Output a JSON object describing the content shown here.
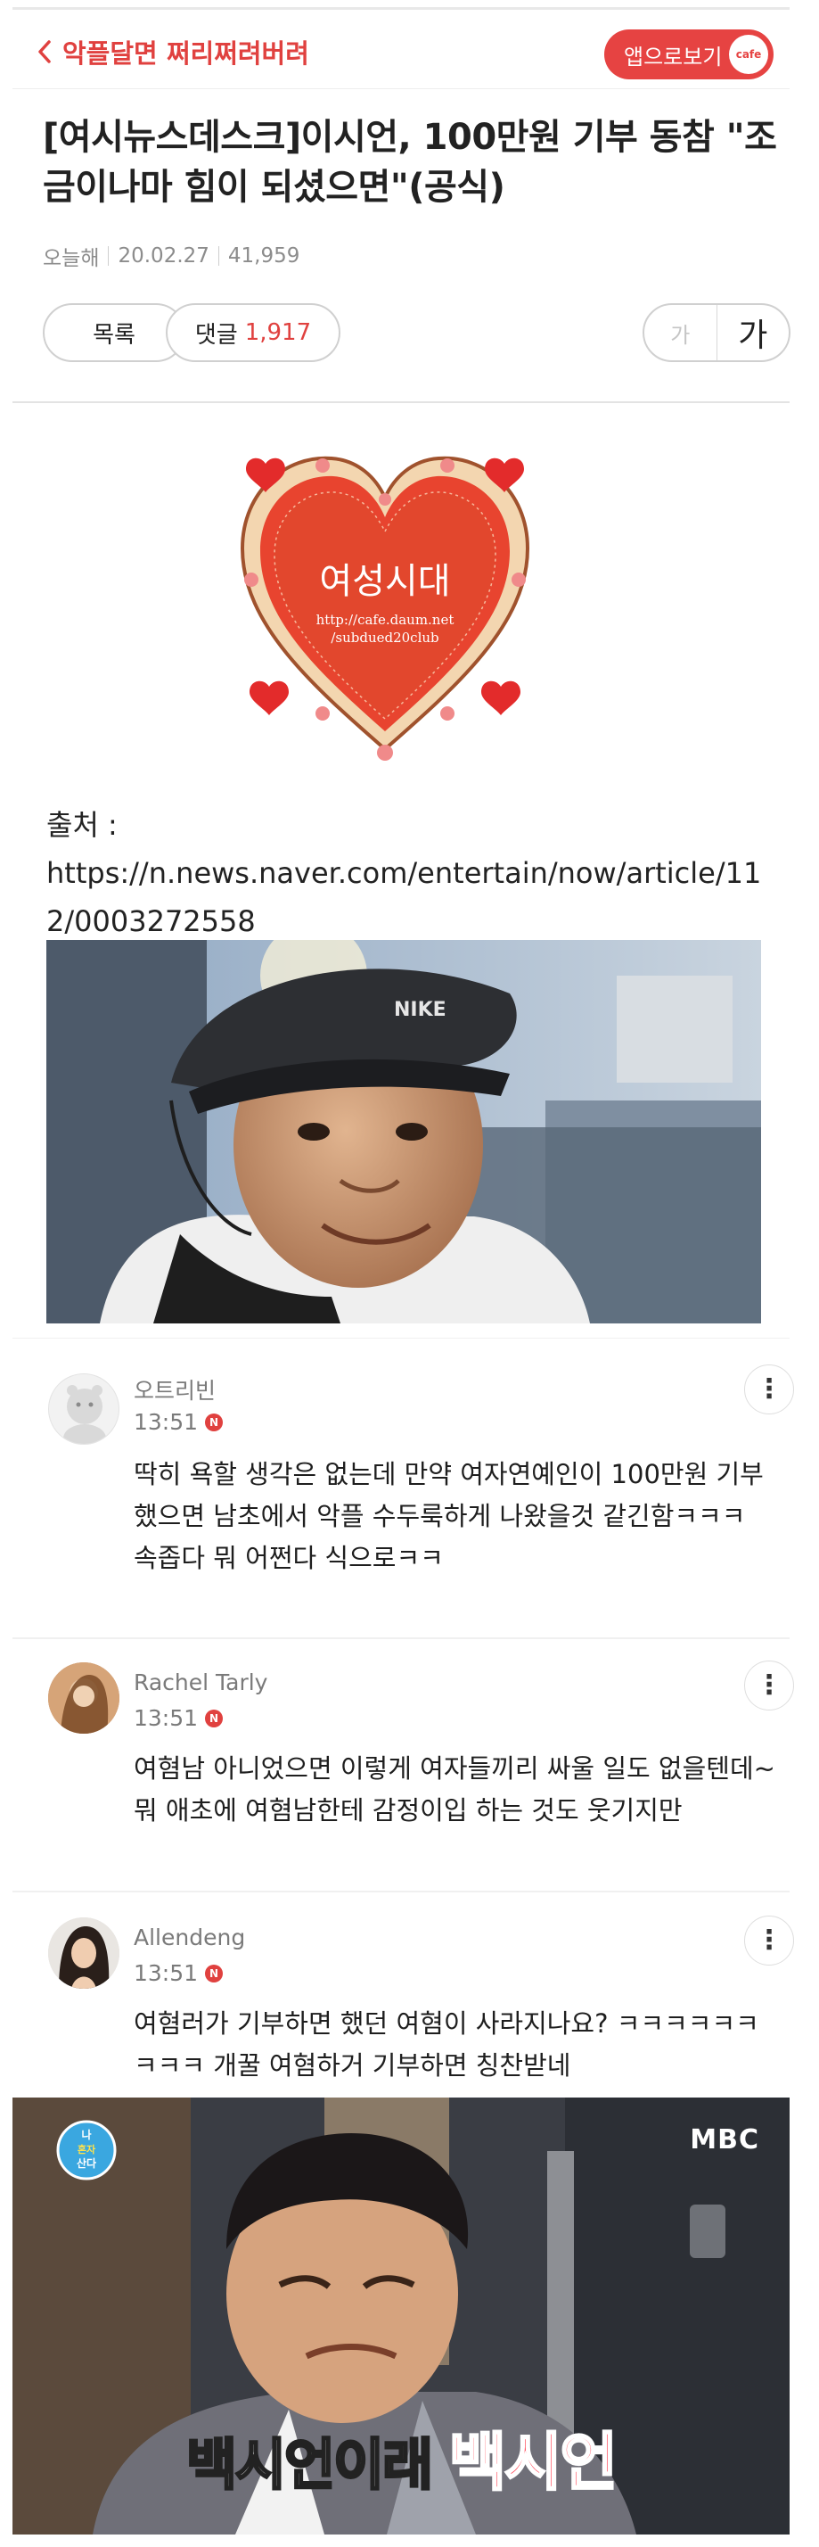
{
  "header": {
    "back_label": "악플달면 쩌리쩌려버려",
    "app_button_label": "앱으로보기",
    "app_badge": "cafe"
  },
  "article": {
    "title": "[여시뉴스데스크]이시언, 100만원 기부 동참 \"조금이나마 힘이 되셨으면\"(공식)",
    "author": "오늘해",
    "date": "20.02.27",
    "views": "41,959",
    "list_button": "목록",
    "comments_label": "댓글",
    "comments_count": "1,917",
    "font_small": "가",
    "font_large": "가"
  },
  "logo": {
    "text": "여성시대",
    "url_line1": "http://cafe.daum.net",
    "url_line2": "/subdued20club"
  },
  "content": {
    "source_label": "출처 :",
    "source_url": "https://n.news.naver.com/entertain/now/article/112/0003272558"
  },
  "photo1": {
    "cap_logo": "NIKE"
  },
  "comments": [
    {
      "name": "오트리빈",
      "time": "13:51",
      "new_badge": "N",
      "text": "딱히 욕할 생각은 없는데 만약 여자연예인이 100만원 기부했으면 남초에서 악플 수두룩하게 나왔을것 같긴함ㅋㅋㅋ 속좁다 뭐 어쩐다 식으로ㅋㅋ"
    },
    {
      "name": "Rachel Tarly",
      "time": "13:51",
      "new_badge": "N",
      "text": "여혐남 아니었으면 이렇게 여자들끼리 싸울 일도 없을텐데~ 뭐 애초에 여혐남한테 감정이입 하는 것도 웃기지만"
    },
    {
      "name": "Allendeng",
      "time": "13:51",
      "new_badge": "N",
      "text": "여혐러가 기부하면 했던 여혐이 사라지나요? ㅋㅋㅋㅋㅋㅋㅋㅋㅋ 개꿀 여혐하거 기부하면 칭찬받네"
    }
  ],
  "photo2": {
    "broadcaster": "MBC",
    "show_badge_line1": "나",
    "show_badge_line2": "혼자",
    "show_badge_line3": "산다",
    "caption_white": "백시언이래",
    "caption_red": "백시언"
  },
  "colors": {
    "accent": "#e0413f",
    "app_button": "#e64342",
    "meta_gray": "#8c8c8c"
  }
}
